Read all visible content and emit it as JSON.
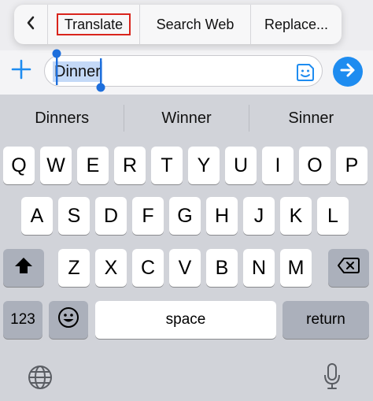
{
  "edit_menu": {
    "back_icon": "chevron-left-icon",
    "items": [
      "Translate",
      "Search Web",
      "Replace..."
    ]
  },
  "input": {
    "text": "Dinner",
    "plus_icon": "plus-icon",
    "sticker_icon": "sticker-icon",
    "send_icon": "arrow-up-icon"
  },
  "suggestions": [
    "Dinners",
    "Winner",
    "Sinner"
  ],
  "keyboard": {
    "row1": [
      "Q",
      "W",
      "E",
      "R",
      "T",
      "Y",
      "U",
      "I",
      "O",
      "P"
    ],
    "row2": [
      "A",
      "S",
      "D",
      "F",
      "G",
      "H",
      "J",
      "K",
      "L"
    ],
    "row3": [
      "Z",
      "X",
      "C",
      "V",
      "B",
      "N",
      "M"
    ],
    "numbers_label": "123",
    "space_label": "space",
    "return_label": "return"
  },
  "colors": {
    "accent": "#1e8cf0",
    "highlight_box": "#d9241c",
    "selection": "#c4d9f7",
    "keyboard_bg": "#d1d3d9"
  }
}
